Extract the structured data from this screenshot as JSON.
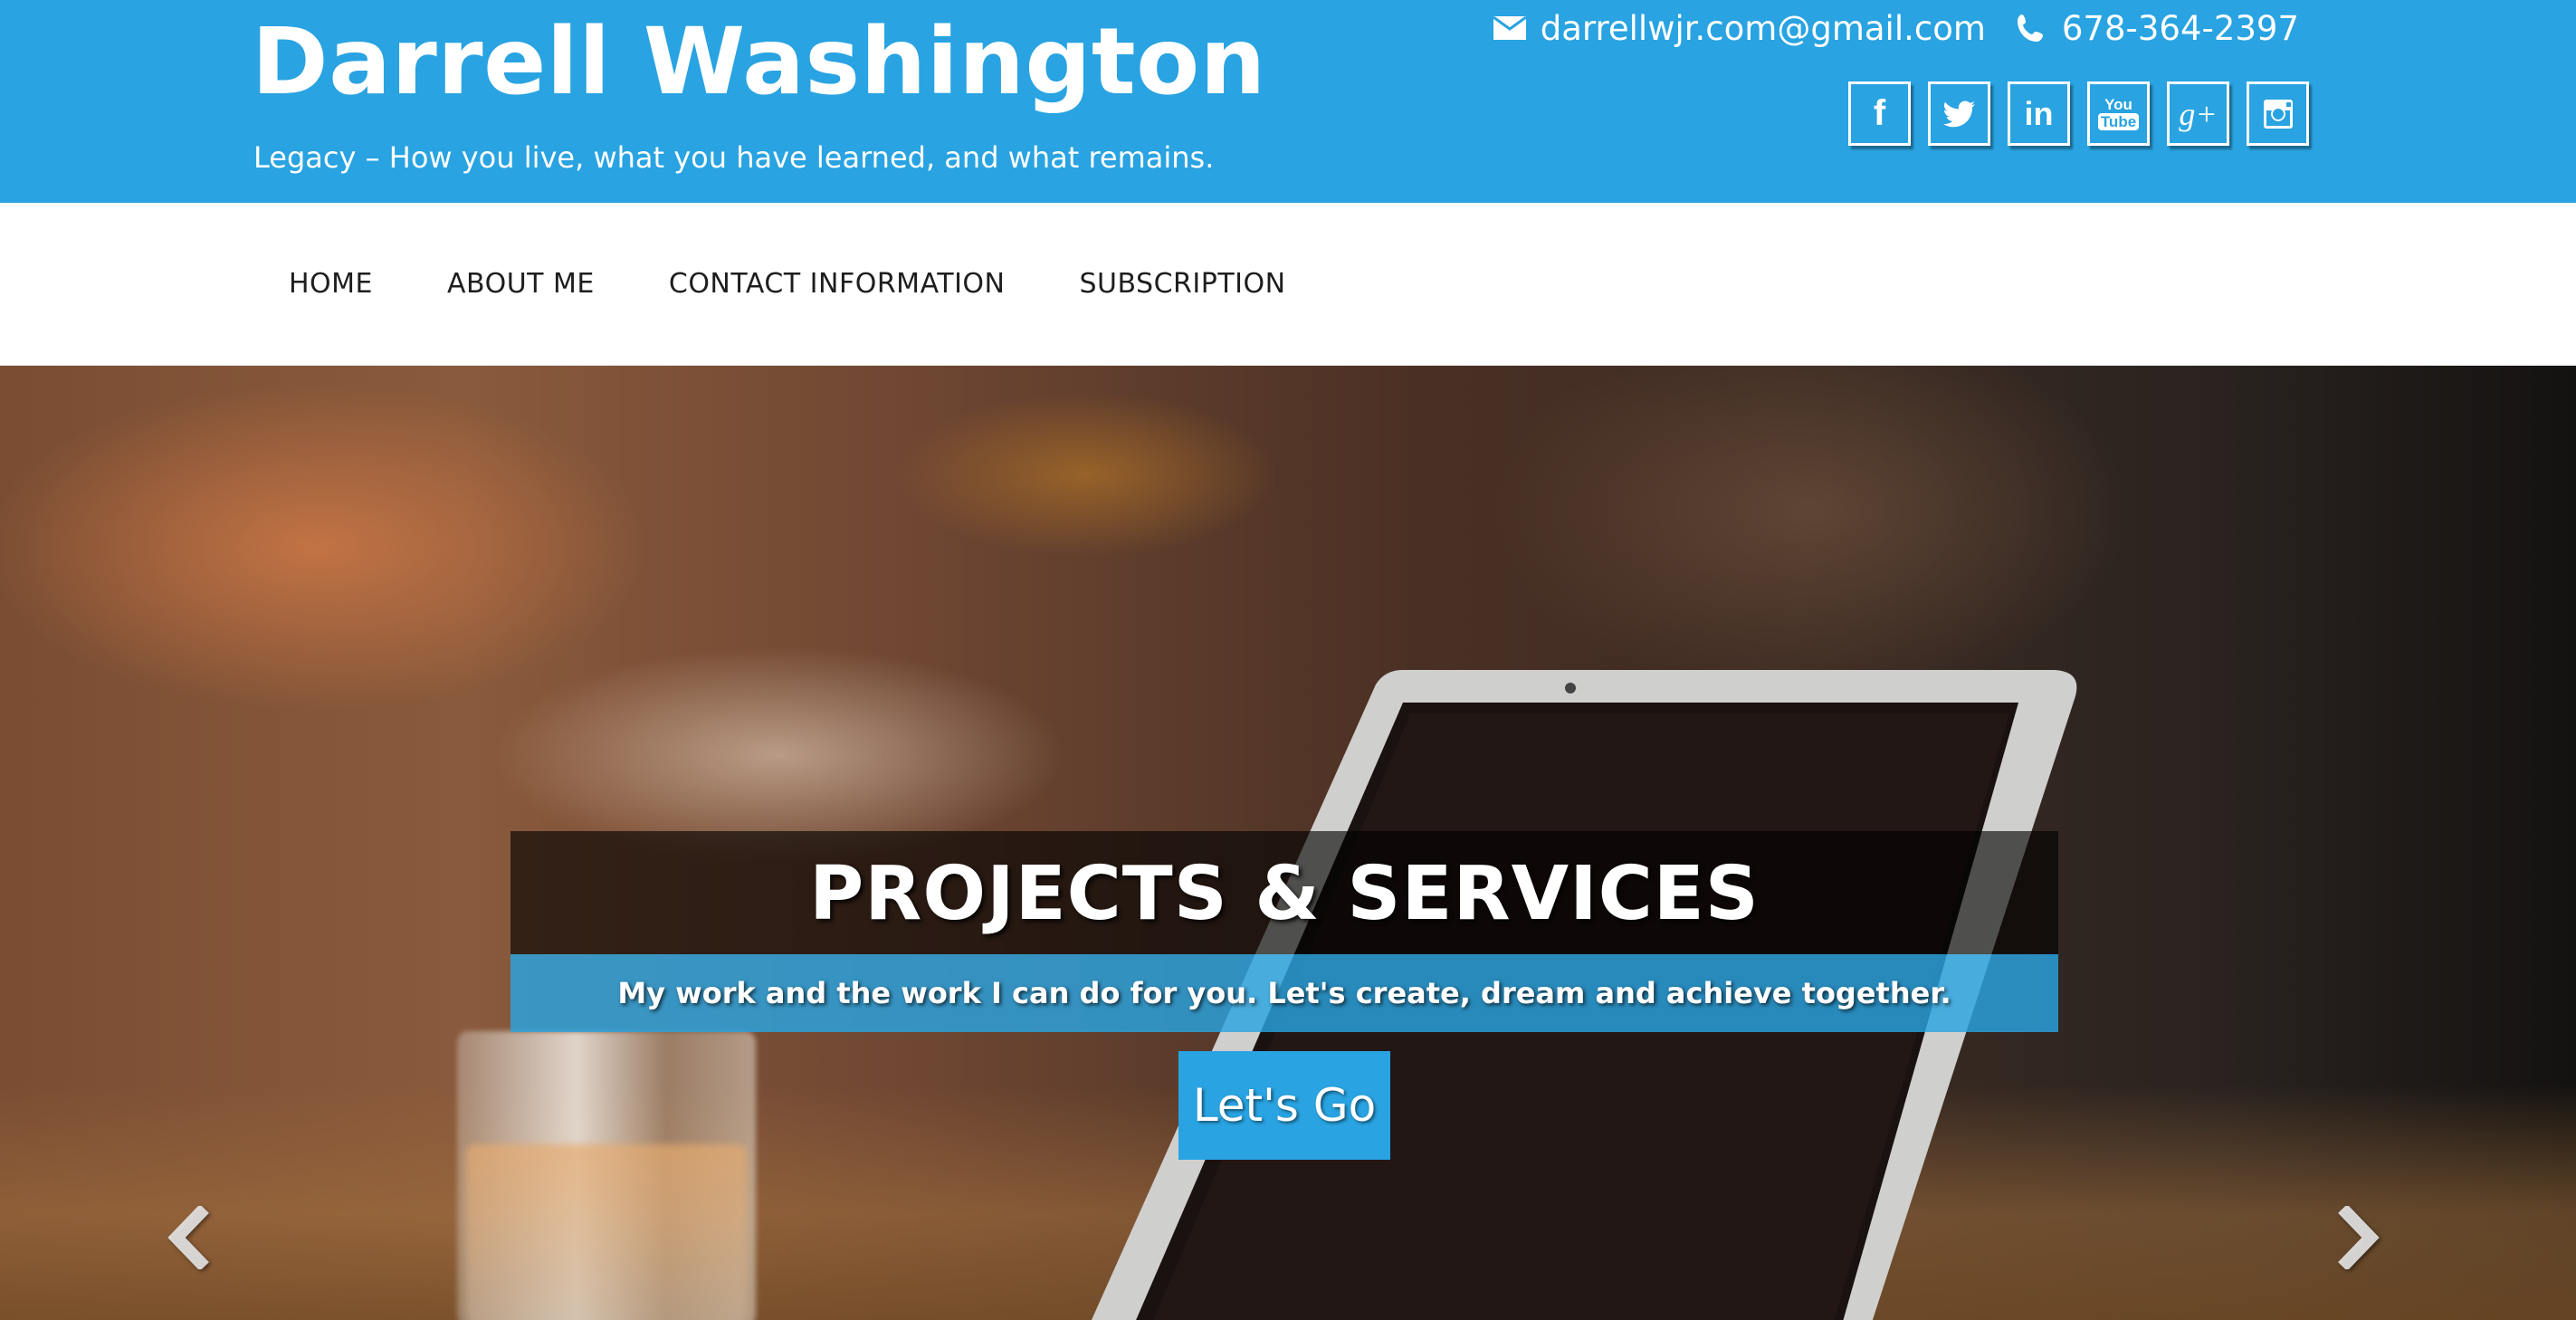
{
  "header": {
    "site_title": "Darrell Washington",
    "tagline": "Legacy – How you live, what you have learned, and what remains.",
    "email": "darrellwjr.com@gmail.com",
    "phone": "678-364-2397",
    "social": [
      {
        "name": "facebook",
        "glyph": "f"
      },
      {
        "name": "twitter",
        "glyph": ""
      },
      {
        "name": "linkedin",
        "glyph": "in"
      },
      {
        "name": "youtube",
        "glyph_top": "You",
        "glyph_bottom": "Tube"
      },
      {
        "name": "google-plus",
        "glyph": "g+"
      },
      {
        "name": "instagram",
        "glyph": ""
      }
    ],
    "background_color": "#29a3e1"
  },
  "nav": {
    "items": [
      {
        "label": "HOME"
      },
      {
        "label": "ABOUT ME"
      },
      {
        "label": "CONTACT INFORMATION"
      },
      {
        "label": "SUBSCRIPTION"
      }
    ]
  },
  "hero": {
    "title": "PROJECTS & SERVICES",
    "subtitle": "My work and the work I can do for you. Let's create, dream and achieve together.",
    "cta_label": "Let's Go",
    "prev_icon": "chevron-left-icon",
    "next_icon": "chevron-right-icon"
  }
}
